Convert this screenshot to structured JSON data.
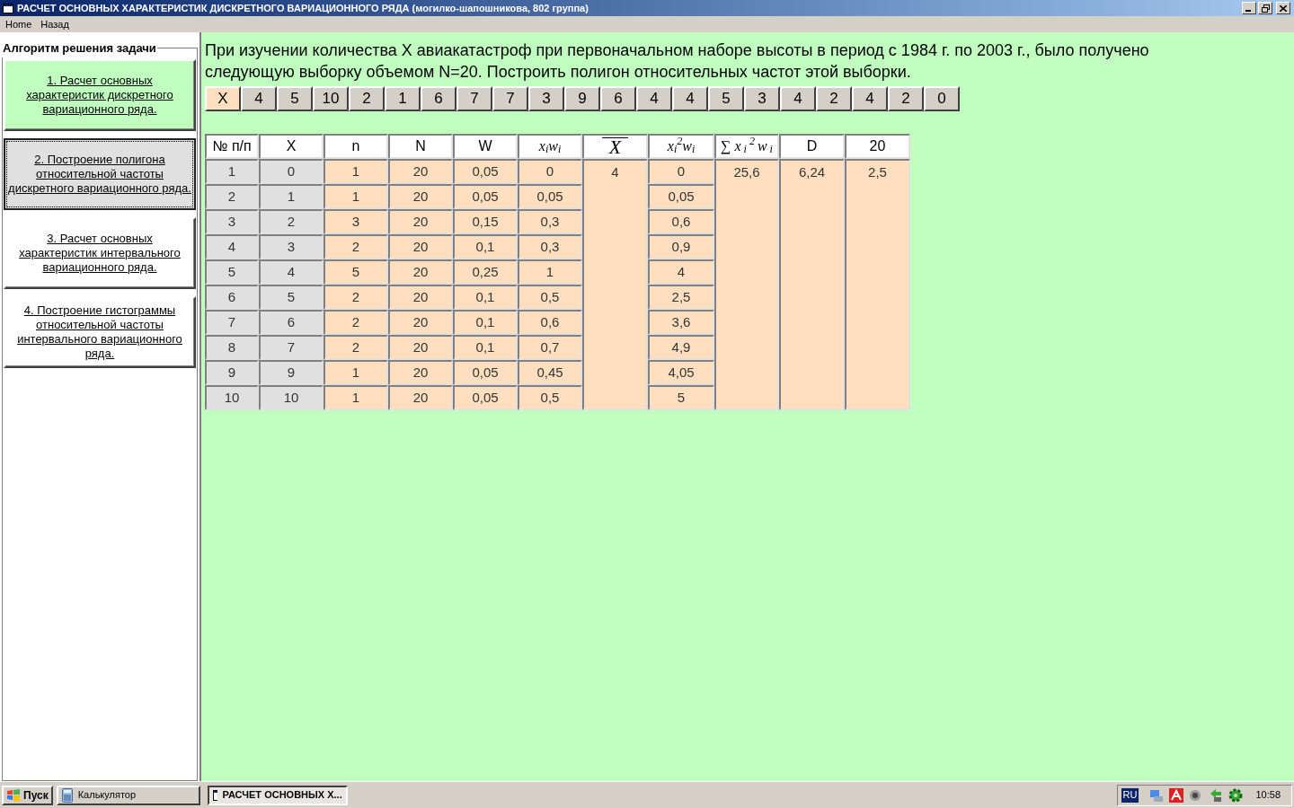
{
  "window": {
    "title": "РАСЧЕТ ОСНОВНЫХ ХАРАКТЕРИСТИК ДИСКРЕТНОГО ВАРИАЦИОННОГО РЯДА (могилко-шапошникова, 802 группа)"
  },
  "menu": [
    "Home",
    "Назад"
  ],
  "sidebar": {
    "title": "Алгоритм решения задачи",
    "items": [
      {
        "label": "1. Расчет основных характеристик дискретного вариационного ряда.",
        "kind": "done",
        "selected": false
      },
      {
        "label": "2. Построение полигона относительной частоты дискретного вариационного ряда.",
        "kind": "todo",
        "selected": true
      },
      {
        "label": "3. Расчет основных характеристик интервального вариационного ряда.",
        "kind": "todo",
        "selected": false
      },
      {
        "label": "4. Построение гистограммы относительной частоты интервального вариационного ряда.",
        "kind": "todo",
        "selected": false
      }
    ]
  },
  "task": "При изучении количества X авиакатастроф при первоначальном наборе высоты в период с 1984 г. по 2003 г., было получено следующую выборку объемом N=20. Построить полигон относительных частот этой выборки.",
  "sample": {
    "label": "X",
    "values": [
      "4",
      "5",
      "10",
      "2",
      "1",
      "6",
      "7",
      "7",
      "3",
      "9",
      "6",
      "4",
      "4",
      "5",
      "3",
      "4",
      "2",
      "4",
      "2",
      "0"
    ]
  },
  "table": {
    "columns": [
      {
        "label": "№ п/п",
        "kind": "plain"
      },
      {
        "label": "X",
        "kind": "plain"
      },
      {
        "label": "n",
        "kind": "plain"
      },
      {
        "label": "N",
        "kind": "plain"
      },
      {
        "label": "W",
        "kind": "plain"
      },
      {
        "label": "x$_{i}$w$_{i}$",
        "kind": "math"
      },
      {
        "label": "X",
        "kind": "mean"
      },
      {
        "label": "x$_{i}$$^{2}$w$_{i}$",
        "kind": "math"
      },
      {
        "label": "∑ x$_{i}$$^{2}$w$_{i}$",
        "kind": "sum"
      },
      {
        "label": "D",
        "kind": "plain"
      },
      {
        "label": "20",
        "kind": "plain"
      }
    ],
    "rows": [
      [
        "1",
        "0",
        "1",
        "20",
        "0,05",
        "0",
        "0"
      ],
      [
        "2",
        "1",
        "1",
        "20",
        "0,05",
        "0,05",
        "0,05"
      ],
      [
        "3",
        "2",
        "3",
        "20",
        "0,15",
        "0,3",
        "0,6"
      ],
      [
        "4",
        "3",
        "2",
        "20",
        "0,1",
        "0,3",
        "0,9"
      ],
      [
        "5",
        "4",
        "5",
        "20",
        "0,25",
        "1",
        "4"
      ],
      [
        "6",
        "5",
        "2",
        "20",
        "0,1",
        "0,5",
        "2,5"
      ],
      [
        "7",
        "6",
        "2",
        "20",
        "0,1",
        "0,6",
        "3,6"
      ],
      [
        "8",
        "7",
        "2",
        "20",
        "0,1",
        "0,7",
        "4,9"
      ],
      [
        "9",
        "9",
        "1",
        "20",
        "0,05",
        "0,45",
        "4,05"
      ],
      [
        "10",
        "10",
        "1",
        "20",
        "0,05",
        "0,5",
        "5"
      ]
    ],
    "mean": "4",
    "sum": "25,6",
    "dispersion": "6,24",
    "deviation": "2,5"
  },
  "taskbar": {
    "start": "Пуск",
    "tasks": [
      {
        "label": "Калькулятор",
        "selected": false
      },
      {
        "label": "РАСЧЕТ ОСНОВНЫХ Х...",
        "selected": true
      }
    ],
    "language": "RU",
    "clock": "10:58"
  }
}
